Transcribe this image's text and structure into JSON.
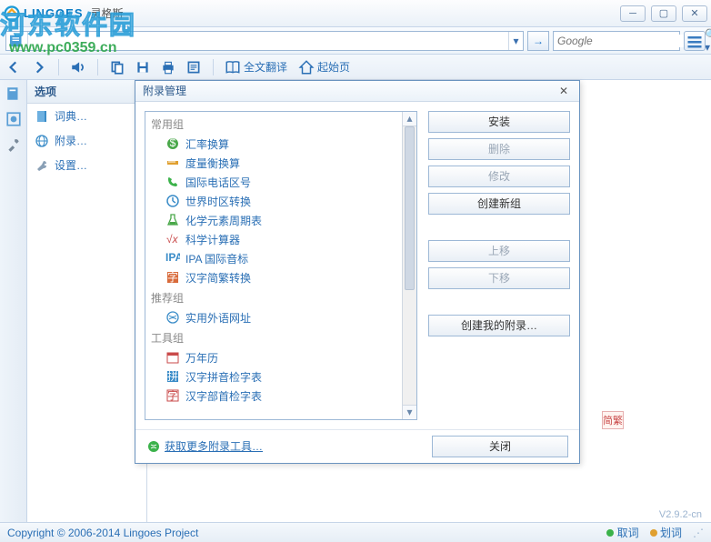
{
  "titlebar": {
    "brand_en": "LINGOES",
    "brand_cn": "灵格斯"
  },
  "watermark": {
    "text": "河东软件园",
    "url": "www.pc0359.cn"
  },
  "searchbar": {
    "go": "→",
    "google_placeholder": "Google",
    "search_icon": "🔍"
  },
  "toolbar": {
    "back": "◀",
    "fwd": "▶",
    "speak": "🔊",
    "copy": "📋",
    "save": "💾",
    "print": "🖨",
    "read": "📑",
    "fulltext_label": "全文翻译",
    "home_label": "起始页"
  },
  "sidebar": {
    "title": "选项",
    "items": [
      {
        "label": "词典…",
        "icon": "dict"
      },
      {
        "label": "附录…",
        "icon": "appendix"
      },
      {
        "label": "设置…",
        "icon": "settings"
      }
    ]
  },
  "dialog": {
    "title": "附录管理",
    "groups": [
      {
        "name": "常用组",
        "items": [
          {
            "label": "汇率换算",
            "icon": "money"
          },
          {
            "label": "度量衡换算",
            "icon": "ruler"
          },
          {
            "label": "国际电话区号",
            "icon": "phone"
          },
          {
            "label": "世界时区转换",
            "icon": "clock"
          },
          {
            "label": "化学元素周期表",
            "icon": "flask"
          },
          {
            "label": "科学计算器",
            "icon": "calc"
          },
          {
            "label": "IPA 国际音标",
            "icon": "ipa"
          },
          {
            "label": "汉字简繁转换",
            "icon": "hanzi"
          }
        ]
      },
      {
        "name": "推荐组",
        "items": [
          {
            "label": "实用外语网址",
            "icon": "globe"
          }
        ]
      },
      {
        "name": "工具组",
        "items": [
          {
            "label": "万年历",
            "icon": "cal"
          },
          {
            "label": "汉字拼音检字表",
            "icon": "pinyin"
          },
          {
            "label": "汉字部首检字表",
            "icon": "radical"
          }
        ]
      }
    ],
    "buttons": {
      "install": "安装",
      "delete": "删除",
      "modify": "修改",
      "newgroup": "创建新组",
      "up": "上移",
      "down": "下移",
      "createmine": "创建我的附录…",
      "close": "关闭"
    },
    "more_link": "获取更多附录工具…"
  },
  "status": {
    "copyright": "Copyright © 2006-2014 Lingoes Project",
    "pick": "取词",
    "stroke": "划词"
  },
  "version": "V2.9.2-cn",
  "badge": "简繁"
}
